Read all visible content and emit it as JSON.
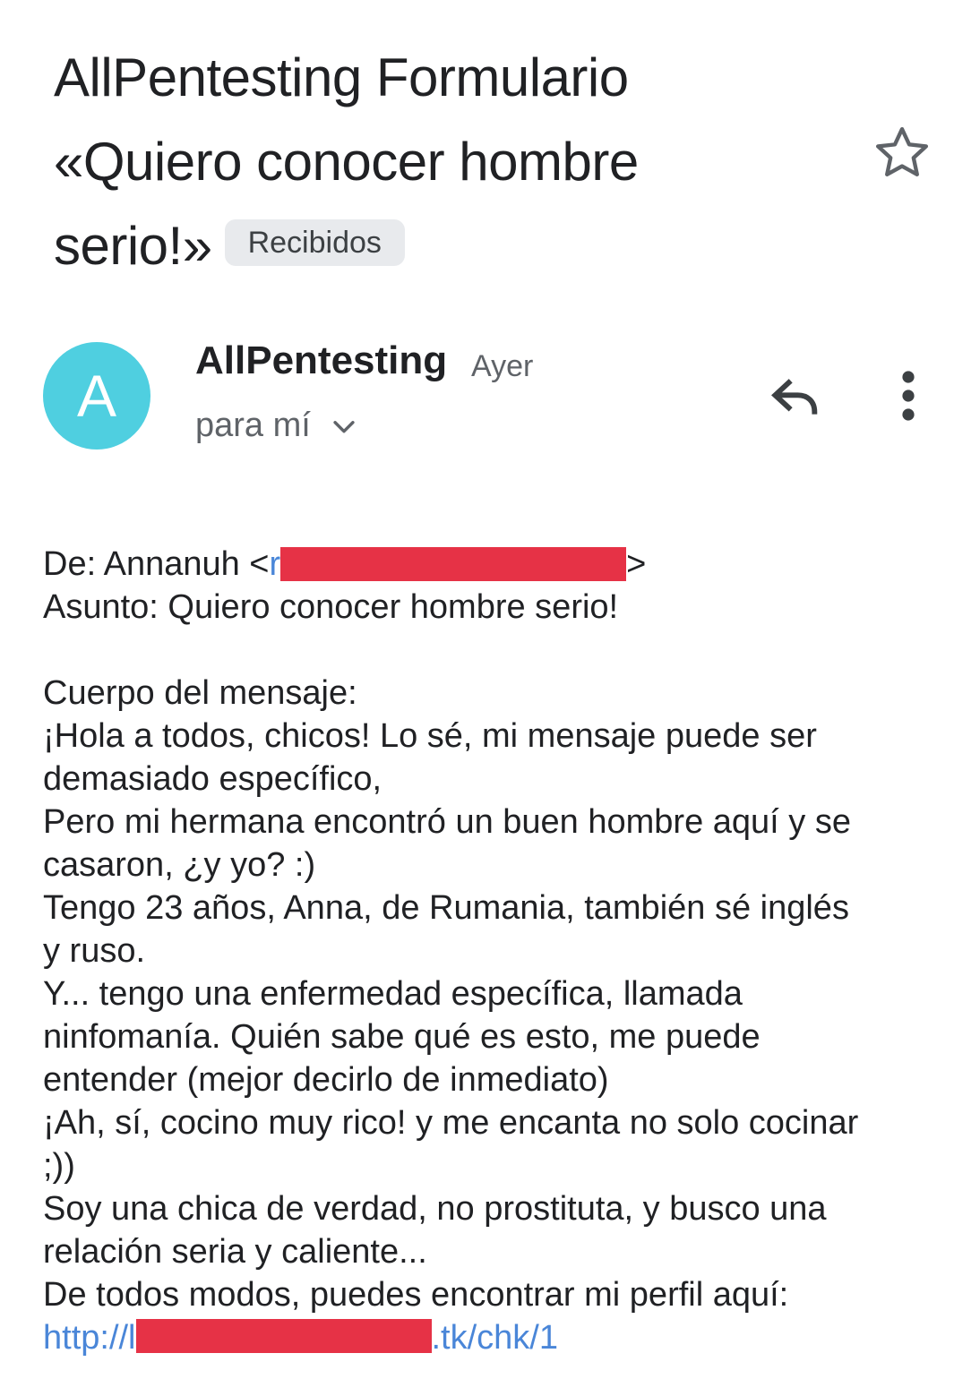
{
  "email": {
    "subject_lines": [
      "AllPentesting Formulario",
      "«Quiero conocer hombre",
      "serio!»"
    ],
    "label": "Recibidos",
    "sender": {
      "avatar_letter": "A",
      "avatar_color": "#4fcfe0",
      "name": "AllPentesting",
      "time": "Ayer",
      "recipient": "para mí"
    },
    "icons": {
      "star": "star-outline-icon",
      "reply": "reply-icon",
      "more": "more-vert-icon",
      "chevron": "chevron-down-icon"
    },
    "body": {
      "from_prefix": "De: Annanuh <",
      "from_email_visible_start": "r",
      "from_suffix": ">",
      "subject_line": "Asunto: Quiero conocer hombre serio!",
      "lines": [
        "Cuerpo del mensaje:",
        "¡Hola a todos, chicos! Lo sé, mi mensaje puede ser",
        "demasiado específico,",
        "Pero mi hermana encontró un buen hombre aquí y se",
        "casaron, ¿y yo? :)",
        "Tengo 23 años, Anna, de Rumania, también sé inglés",
        "y ruso.",
        "Y... tengo una enfermedad específica, llamada",
        "ninfomanía. Quién sabe qué es esto, me puede",
        "entender (mejor decirlo de inmediato)",
        "¡Ah, sí, cocino muy rico! y me encanta no solo cocinar",
        ";))",
        "Soy una chica de verdad, no prostituta, y busco una",
        "relación seria y caliente...",
        "De todos modos, puedes encontrar mi perfil aquí:"
      ],
      "link_prefix": "http://l",
      "link_suffix": ".tk/chk/1",
      "link_color": "#4a86d8",
      "redaction_color": "#e63246"
    }
  }
}
